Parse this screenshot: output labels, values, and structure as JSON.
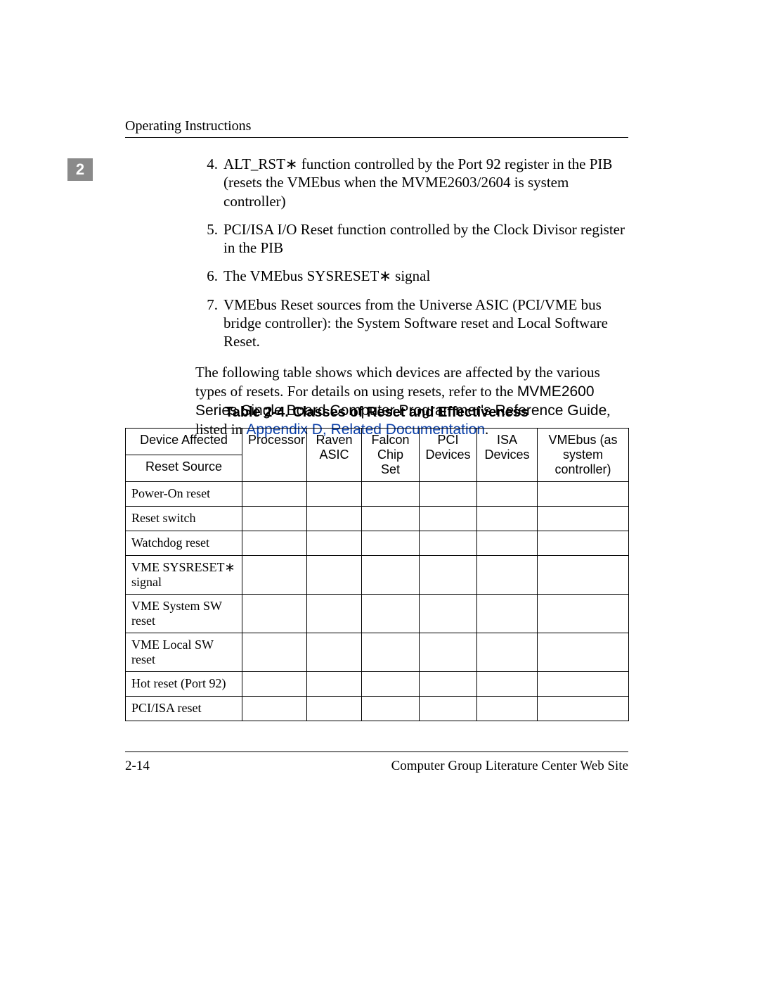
{
  "header": {
    "running_head": "Operating Instructions",
    "chapter_number": "2"
  },
  "list": {
    "items": [
      {
        "num": "4.",
        "text": "ALT_RST∗ function controlled by the Port 92 register in the PIB (resets the VMEbus when the MVME2603/2604 is system controller)"
      },
      {
        "num": "5.",
        "text": "PCI/ISA I/O Reset function controlled by the Clock Divisor register in the PIB"
      },
      {
        "num": "6.",
        "text": "The VMEbus SYSRESET∗ signal"
      },
      {
        "num": "7.",
        "text": "VMEbus Reset sources from the Universe ASIC (PCI/VME bus bridge controller): the System Software reset and Local Software Reset."
      }
    ]
  },
  "paragraph": {
    "pre": "The following table shows which devices are affected by the various types of resets. For details on using resets, refer to the ",
    "ref1": "MVME2600 Series Single Board Computer Programmer's Reference Guide",
    "mid": ", listed in ",
    "link_text": "Appendix D, Related Documentation",
    "post": "."
  },
  "table": {
    "caption": "Table 2-4.  Classes of Reset and Effectiveness",
    "header_row1": [
      "Device Affected",
      "Processor",
      "Raven ASIC",
      "Falcon Chip Set",
      "PCI Devices",
      "ISA Devices",
      "VMEbus (as system controller)"
    ],
    "header_row2_col0": "Reset Source",
    "rows": [
      "Power-On reset",
      "Reset switch",
      "Watchdog reset",
      "VME SYSRESET∗ signal",
      "VME System SW reset",
      "VME Local SW reset",
      "Hot reset (Port 92)",
      "PCI/ISA reset"
    ]
  },
  "footer": {
    "page_number": "2-14",
    "right": "Computer Group Literature Center Web Site"
  }
}
